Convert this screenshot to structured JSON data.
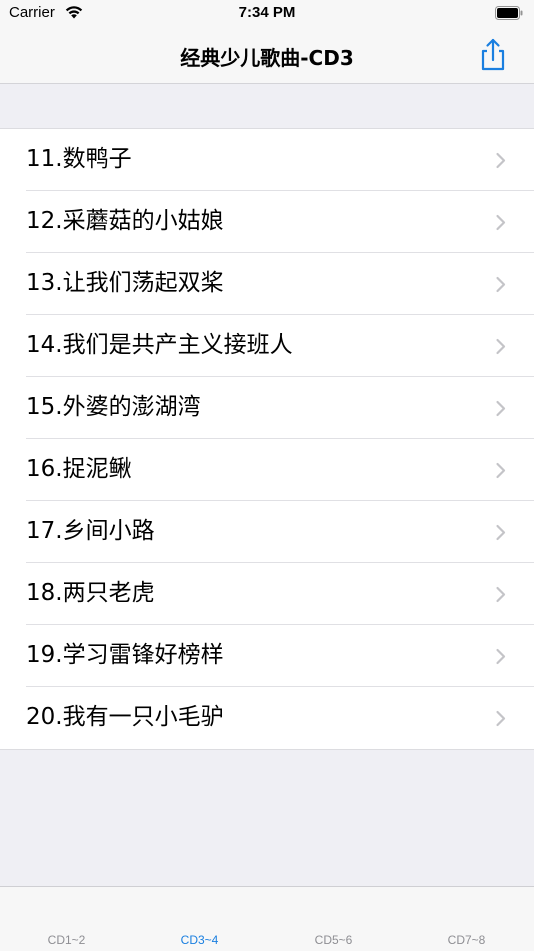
{
  "status_bar": {
    "carrier": "Carrier",
    "time": "7:34 PM"
  },
  "nav": {
    "title": "经典少儿歌曲-CD3",
    "share_icon": "share-icon",
    "accent_color": "#1a7fe0"
  },
  "songs": [
    {
      "label": "11.数鸭子"
    },
    {
      "label": "12.采蘑菇的小姑娘"
    },
    {
      "label": "13.让我们荡起双桨"
    },
    {
      "label": "14.我们是共产主义接班人"
    },
    {
      "label": "15.外婆的澎湖湾"
    },
    {
      "label": "16.捉泥鳅"
    },
    {
      "label": "17.乡间小路"
    },
    {
      "label": "18.两只老虎"
    },
    {
      "label": "19.学习雷锋好榜样"
    },
    {
      "label": "20.我有一只小毛驴"
    }
  ],
  "tabs": [
    {
      "label": "CD1~2",
      "active": false
    },
    {
      "label": "CD3~4",
      "active": true
    },
    {
      "label": "CD5~6",
      "active": false
    },
    {
      "label": "CD7~8",
      "active": false
    }
  ]
}
